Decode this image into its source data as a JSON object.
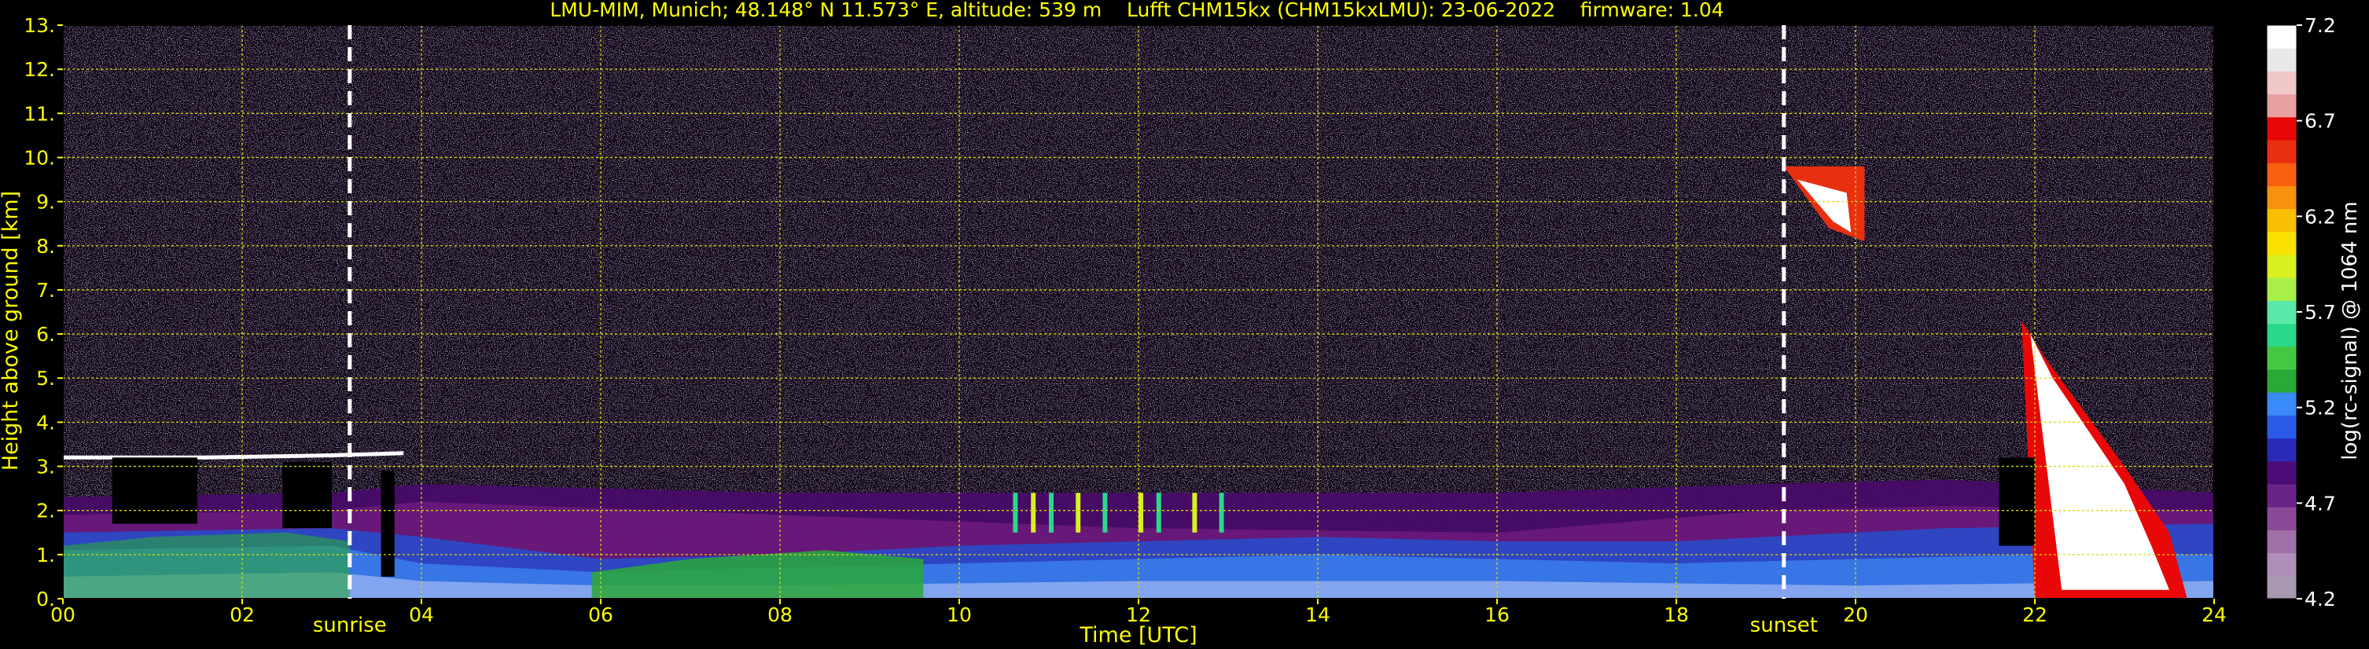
{
  "chart_data": {
    "type": "heatmap",
    "title": "LMU-MIM, Munich; 48.148° N 11.573° E, altitude: 539 m    Lufft CHM15kx (CHM15kxLMU): 23-06-2022    firmware: 1.04",
    "xlabel": "Time [UTC]",
    "ylabel": "Height above ground [km]",
    "xlim": [
      0,
      24
    ],
    "ylim": [
      0,
      13
    ],
    "x_ticks": [
      "00",
      "02",
      "04",
      "06",
      "08",
      "10",
      "12",
      "14",
      "16",
      "18",
      "20",
      "22",
      "24"
    ],
    "y_ticks": [
      "0.",
      "1.",
      "2.",
      "3.",
      "4.",
      "5.",
      "6.",
      "7.",
      "8.",
      "9.",
      "10.",
      "11.",
      "12.",
      "13."
    ],
    "grid": true,
    "colorbar": {
      "label": "log(rc-signal) @ 1064 nm",
      "range": [
        4.2,
        7.2
      ],
      "ticks": [
        "4.2",
        "4.7",
        "5.2",
        "5.7",
        "6.2",
        "6.7",
        "7.2"
      ],
      "colors": [
        "#a898b0",
        "#b090b8",
        "#a070a8",
        "#8a4a98",
        "#6a2488",
        "#4c0c78",
        "#2a2ab8",
        "#2a5ae8",
        "#3a8af8",
        "#2aa838",
        "#44c844",
        "#2ad88a",
        "#5ae8a8",
        "#a8f048",
        "#d8f020",
        "#f8e000",
        "#f8c000",
        "#f89010",
        "#f86010",
        "#e83010",
        "#e80808",
        "#e8a0a0",
        "#f0c8c8",
        "#e8e8e8",
        "#ffffff"
      ]
    },
    "markers": [
      {
        "x": 3.2,
        "label": "sunrise"
      },
      {
        "x": 19.2,
        "label": "sunset"
      }
    ],
    "features": [
      {
        "name": "low-level aerosol layer",
        "x": [
          0,
          24
        ],
        "y": [
          0,
          2.5
        ]
      },
      {
        "name": "cirrus 19.2-20.2h",
        "x": [
          19.2,
          20.2
        ],
        "y": [
          8,
          9.8
        ]
      },
      {
        "name": "cloud 21.8-23.8h",
        "x": [
          21.8,
          23.8
        ],
        "y": [
          0,
          6.5
        ]
      }
    ]
  }
}
